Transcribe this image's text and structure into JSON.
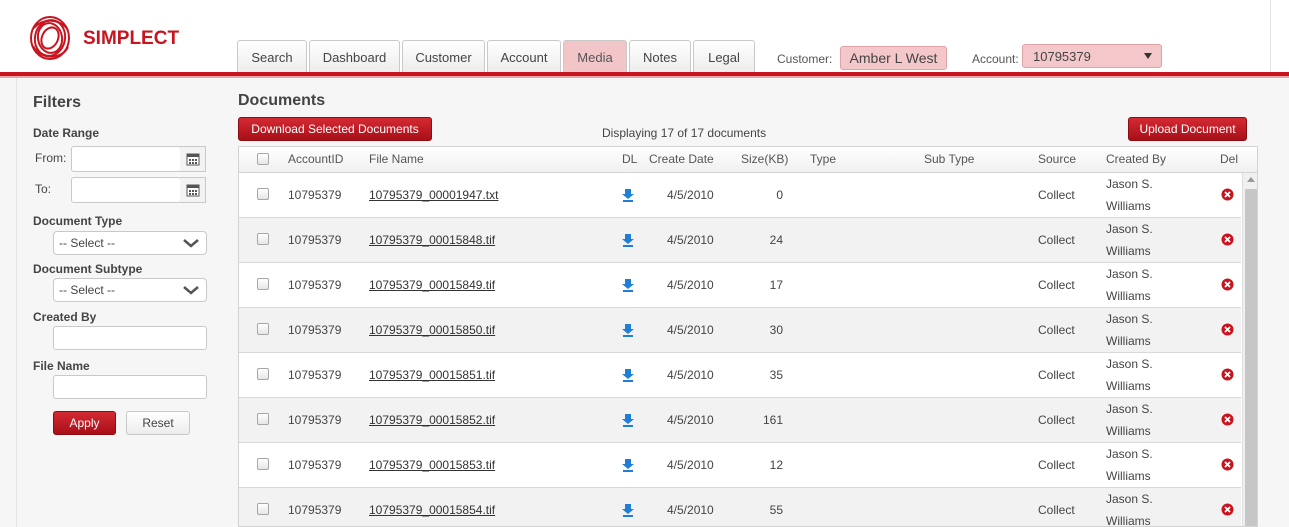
{
  "brand": {
    "name": "SIMPLECT",
    "accent": "#c8141f"
  },
  "tabs": [
    {
      "label": "Search"
    },
    {
      "label": "Dashboard"
    },
    {
      "label": "Customer"
    },
    {
      "label": "Account"
    },
    {
      "label": "Media",
      "active": true
    },
    {
      "label": "Notes"
    },
    {
      "label": "Legal"
    }
  ],
  "header": {
    "customer_label": "Customer:",
    "customer_name": "Amber L West",
    "account_label": "Account:",
    "account_value": "10795379"
  },
  "filters": {
    "title": "Filters",
    "date_range_label": "Date Range",
    "from_label": "From:",
    "to_label": "To:",
    "from_value": "",
    "to_value": "",
    "document_type_label": "Document Type",
    "document_type_value": "-- Select --",
    "document_subtype_label": "Document Subtype",
    "document_subtype_value": "-- Select --",
    "created_by_label": "Created By",
    "created_by_value": "",
    "file_name_label": "File Name",
    "file_name_value": "",
    "apply_label": "Apply",
    "reset_label": "Reset"
  },
  "documents": {
    "title": "Documents",
    "download_selected_label": "Download Selected Documents",
    "display_count": "Displaying 17 of 17 documents",
    "upload_label": "Upload Document",
    "columns": [
      "AccountID",
      "File Name",
      "DL",
      "Create Date",
      "Size(KB)",
      "Type",
      "Sub Type",
      "Source",
      "Created By",
      "Del"
    ],
    "rows": [
      {
        "account": "10795379",
        "file": "10795379_00001947.txt",
        "date": "4/5/2010",
        "size": "0",
        "type": "",
        "subtype": "",
        "source": "Collect",
        "by1": "Jason S.",
        "by2": "Williams"
      },
      {
        "account": "10795379",
        "file": "10795379_00015848.tif",
        "date": "4/5/2010",
        "size": "24",
        "type": "",
        "subtype": "",
        "source": "Collect",
        "by1": "Jason S.",
        "by2": "Williams"
      },
      {
        "account": "10795379",
        "file": "10795379_00015849.tif",
        "date": "4/5/2010",
        "size": "17",
        "type": "",
        "subtype": "",
        "source": "Collect",
        "by1": "Jason S.",
        "by2": "Williams"
      },
      {
        "account": "10795379",
        "file": "10795379_00015850.tif",
        "date": "4/5/2010",
        "size": "30",
        "type": "",
        "subtype": "",
        "source": "Collect",
        "by1": "Jason S.",
        "by2": "Williams"
      },
      {
        "account": "10795379",
        "file": "10795379_00015851.tif",
        "date": "4/5/2010",
        "size": "35",
        "type": "",
        "subtype": "",
        "source": "Collect",
        "by1": "Jason S.",
        "by2": "Williams"
      },
      {
        "account": "10795379",
        "file": "10795379_00015852.tif",
        "date": "4/5/2010",
        "size": "161",
        "type": "",
        "subtype": "",
        "source": "Collect",
        "by1": "Jason S.",
        "by2": "Williams"
      },
      {
        "account": "10795379",
        "file": "10795379_00015853.tif",
        "date": "4/5/2010",
        "size": "12",
        "type": "",
        "subtype": "",
        "source": "Collect",
        "by1": "Jason S.",
        "by2": "Williams"
      },
      {
        "account": "10795379",
        "file": "10795379_00015854.tif",
        "date": "4/5/2010",
        "size": "55",
        "type": "",
        "subtype": "",
        "source": "Collect",
        "by1": "Jason S.",
        "by2": "Williams"
      }
    ]
  },
  "icons": {
    "download": "download-arrow-icon",
    "delete": "delete-x-icon",
    "calendar": "calendar-icon",
    "dropdown": "chevron-down-icon"
  },
  "colors": {
    "download_icon": "#1f7fd6",
    "delete_icon": "#c8141f",
    "tab_active": "#f2c6c9"
  }
}
